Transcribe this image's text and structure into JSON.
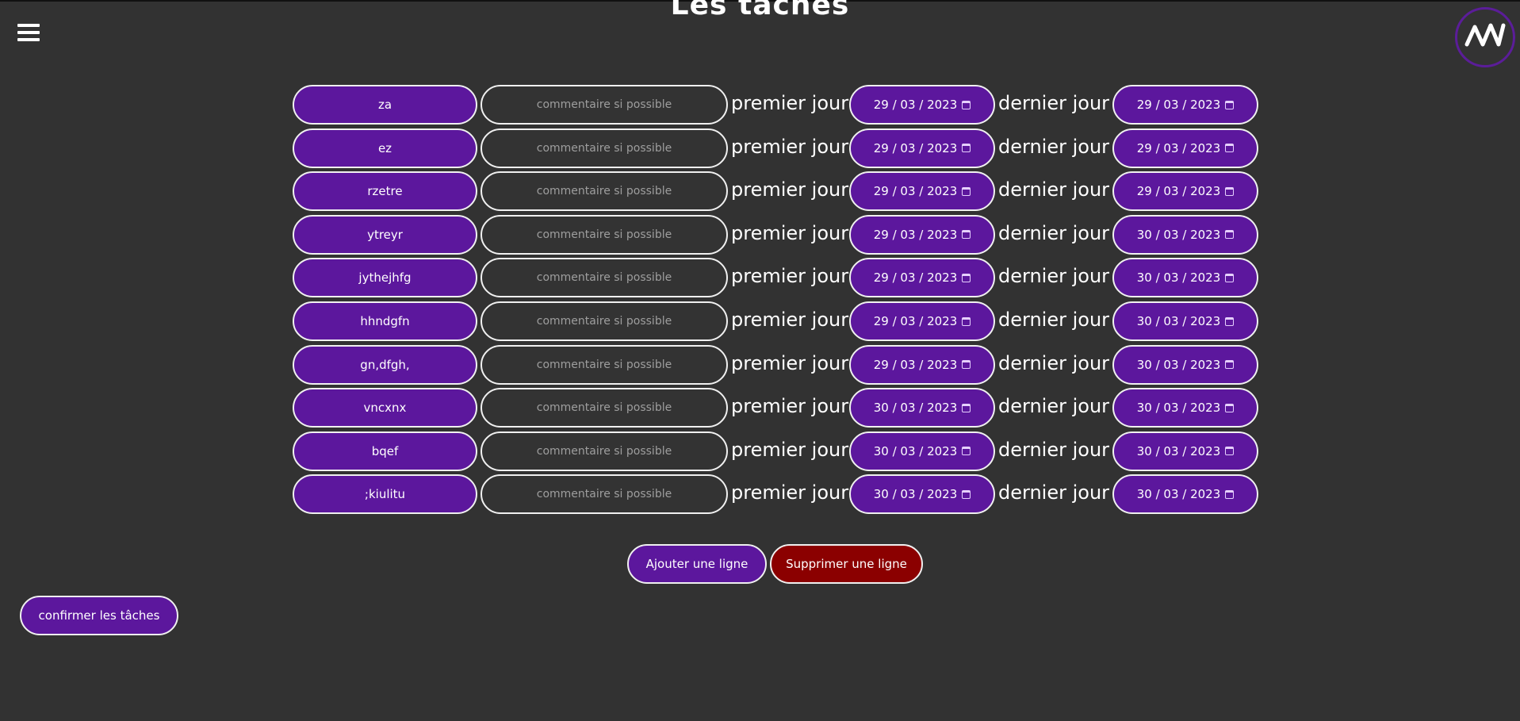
{
  "page": {
    "title": "Les tâches"
  },
  "menu": {
    "icon": "hamburger-menu-icon"
  },
  "logo": {
    "icon": "brand-logo-icon"
  },
  "labels": {
    "first_day": "premier jour :",
    "last_day": "dernier jour :"
  },
  "comment_placeholder": "commentaire si possible",
  "tasks": [
    {
      "name": "za",
      "first": "29 / 03 / 2023",
      "last": "29 / 03 / 2023"
    },
    {
      "name": "ez",
      "first": "29 / 03 / 2023",
      "last": "29 / 03 / 2023"
    },
    {
      "name": "rzetre",
      "first": "29 / 03 / 2023",
      "last": "29 / 03 / 2023"
    },
    {
      "name": "ytreyr",
      "first": "29 / 03 / 2023",
      "last": "30 / 03 / 2023"
    },
    {
      "name": "jythejhfg",
      "first": "29 / 03 / 2023",
      "last": "30 / 03 / 2023"
    },
    {
      "name": "hhndgfn",
      "first": "29 / 03 / 2023",
      "last": "30 / 03 / 2023"
    },
    {
      "name": "gn,dfgh,",
      "first": "29 / 03 / 2023",
      "last": "30 / 03 / 2023"
    },
    {
      "name": "vncxnx",
      "first": "30 / 03 / 2023",
      "last": "30 / 03 / 2023"
    },
    {
      "name": "bqef",
      "first": "30 / 03 / 2023",
      "last": "30 / 03 / 2023"
    },
    {
      "name": ";kiulitu",
      "first": "30 / 03 / 2023",
      "last": "30 / 03 / 2023"
    }
  ],
  "buttons": {
    "add": "Ajouter une ligne",
    "delete": "Supprimer une ligne",
    "confirm": "confirmer les tâches"
  },
  "colors": {
    "accent": "#5c179d",
    "danger": "#8b0000",
    "background": "#323232"
  }
}
